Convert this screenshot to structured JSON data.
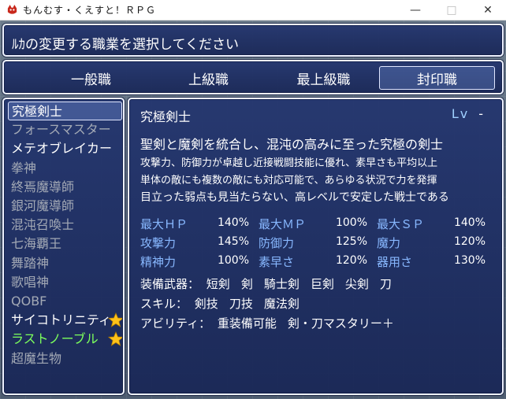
{
  "window": {
    "title": "もんむす・くえすと！ＲＰＧ",
    "minimize": "—",
    "maximize": "□",
    "close": "✕"
  },
  "help_text": "ﾙｶの変更する職業を選択してください",
  "tabs": [
    {
      "label": "一般職",
      "selected": false
    },
    {
      "label": "上級職",
      "selected": false
    },
    {
      "label": "最上級職",
      "selected": false
    },
    {
      "label": "封印職",
      "selected": true
    }
  ],
  "job_list": [
    {
      "label": "究極剣士",
      "style": "bright",
      "cursor": true,
      "star": false
    },
    {
      "label": "フォースマスター",
      "style": "dim",
      "cursor": false,
      "star": false
    },
    {
      "label": "メテオブレイカー",
      "style": "bright",
      "cursor": false,
      "star": false
    },
    {
      "label": "拳神",
      "style": "dim",
      "cursor": false,
      "star": false
    },
    {
      "label": "終焉魔導師",
      "style": "dim",
      "cursor": false,
      "star": false
    },
    {
      "label": "銀河魔導師",
      "style": "dim",
      "cursor": false,
      "star": false
    },
    {
      "label": "混沌召喚士",
      "style": "dim",
      "cursor": false,
      "star": false
    },
    {
      "label": "七海覇王",
      "style": "dim",
      "cursor": false,
      "star": false
    },
    {
      "label": "舞踏神",
      "style": "dim",
      "cursor": false,
      "star": false
    },
    {
      "label": "歌唱神",
      "style": "dim",
      "cursor": false,
      "star": false
    },
    {
      "label": "QOBF",
      "style": "dim",
      "cursor": false,
      "star": false
    },
    {
      "label": "サイコトリニティ",
      "style": "bright",
      "cursor": false,
      "star": true
    },
    {
      "label": "ラストノーブル",
      "style": "green",
      "cursor": false,
      "star": true
    },
    {
      "label": "超魔生物",
      "style": "dim",
      "cursor": false,
      "star": false
    }
  ],
  "detail": {
    "name": "究極剣士",
    "lv_label": "Lv",
    "lv_value": "-",
    "desc": [
      "聖剣と魔剣を統合し、混沌の高みに至った究極の剣士",
      "攻撃力、防御力が卓越し近接戦闘技能に優れ、素早さも平均以上",
      "単体の敵にも複数の敵にも対応可能で、あらゆる状況で力を発揮",
      "目立った弱点も見当たらない、高レベルで安定した戦士である"
    ],
    "stats": [
      [
        {
          "label": "最大ＨＰ",
          "value": "140%"
        },
        {
          "label": "最大ＭＰ",
          "value": "100%"
        },
        {
          "label": "最大ＳＰ",
          "value": "140%"
        }
      ],
      [
        {
          "label": "攻撃力",
          "value": "145%"
        },
        {
          "label": "防御力",
          "value": "125%"
        },
        {
          "label": "魔力",
          "value": "120%"
        }
      ],
      [
        {
          "label": "精神力",
          "value": "100%"
        },
        {
          "label": "素早さ",
          "value": "120%"
        },
        {
          "label": "器用さ",
          "value": "130%"
        }
      ]
    ],
    "equipment": {
      "weapon_label": "装備武器：",
      "weapons": [
        "短剣",
        "剣",
        "騎士剣",
        "巨剣",
        "尖剣",
        "刀"
      ],
      "skill_label": "スキル：",
      "skills": [
        "剣技",
        "刀技",
        "魔法剣"
      ],
      "ability_label": "アビリティ：",
      "abilities": [
        "重装備可能",
        "剣・刀マスタリー＋"
      ]
    }
  },
  "colors": {
    "panel": "#22346e",
    "stat_label": "#88b8ff",
    "lv_label": "#9fd0ff",
    "dim_text": "#a3a9b5",
    "green_text": "#7cff5c",
    "star": "#ffc21a"
  }
}
